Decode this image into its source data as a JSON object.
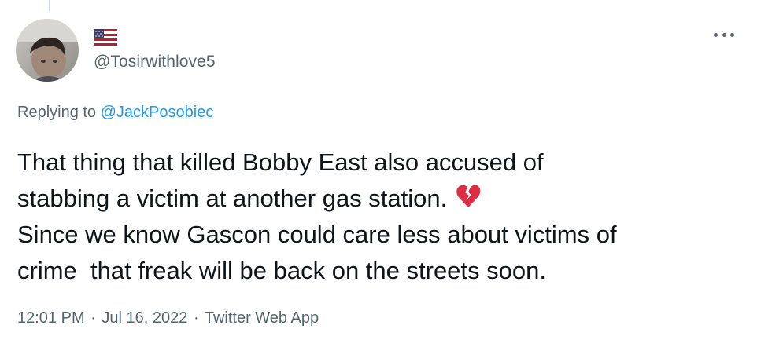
{
  "tweet": {
    "flag_icon": "us-flag-icon",
    "handle": "@Tosirwithlove5",
    "more_icon": "more-options-icon",
    "replying_prefix": "Replying to ",
    "replying_to": "@JackPosobiec",
    "text_lines": [
      "That thing that killed Bobby East also accused of",
      "stabbing a victim at another gas station.",
      "Since we know Gascon could care less about victims of",
      "crime  that freak will be back on the streets soon."
    ],
    "emoji_icon": "broken-heart-icon",
    "time": "12:01 PM",
    "date": "Jul 16, 2022",
    "separator": "·",
    "source": "Twitter Web App"
  },
  "colors": {
    "text": "#0f1419",
    "secondary": "#536471",
    "link": "#1d9bf0",
    "emoji": "#dd2e44"
  }
}
